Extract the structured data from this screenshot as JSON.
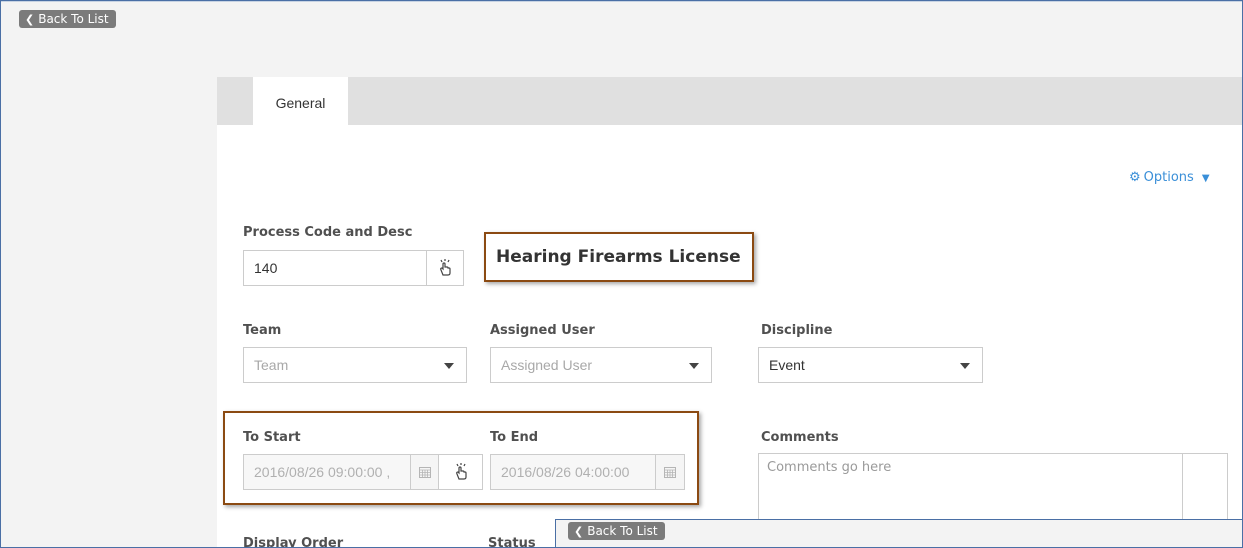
{
  "nav": {
    "back_label": "Back To List"
  },
  "tabs": [
    {
      "label": "General"
    }
  ],
  "options": {
    "label": "Options"
  },
  "process": {
    "label": "Process Code and Desc",
    "code": "140",
    "description": "Hearing Firearms License"
  },
  "team": {
    "label": "Team",
    "placeholder": "Team"
  },
  "assigned_user": {
    "label": "Assigned User",
    "placeholder": "Assigned User"
  },
  "discipline": {
    "label": "Discipline",
    "value": "Event"
  },
  "to_start": {
    "label": "To Start",
    "value": "2016/08/26 09:00:00 ,"
  },
  "to_end": {
    "label": "To End",
    "value": "2016/08/26 04:00:00"
  },
  "comments": {
    "label": "Comments",
    "placeholder": "Comments go here"
  },
  "bottom": {
    "display_order_label": "Display Order",
    "status_label": "Status"
  },
  "overlay": {
    "back_label": "Back To List"
  }
}
